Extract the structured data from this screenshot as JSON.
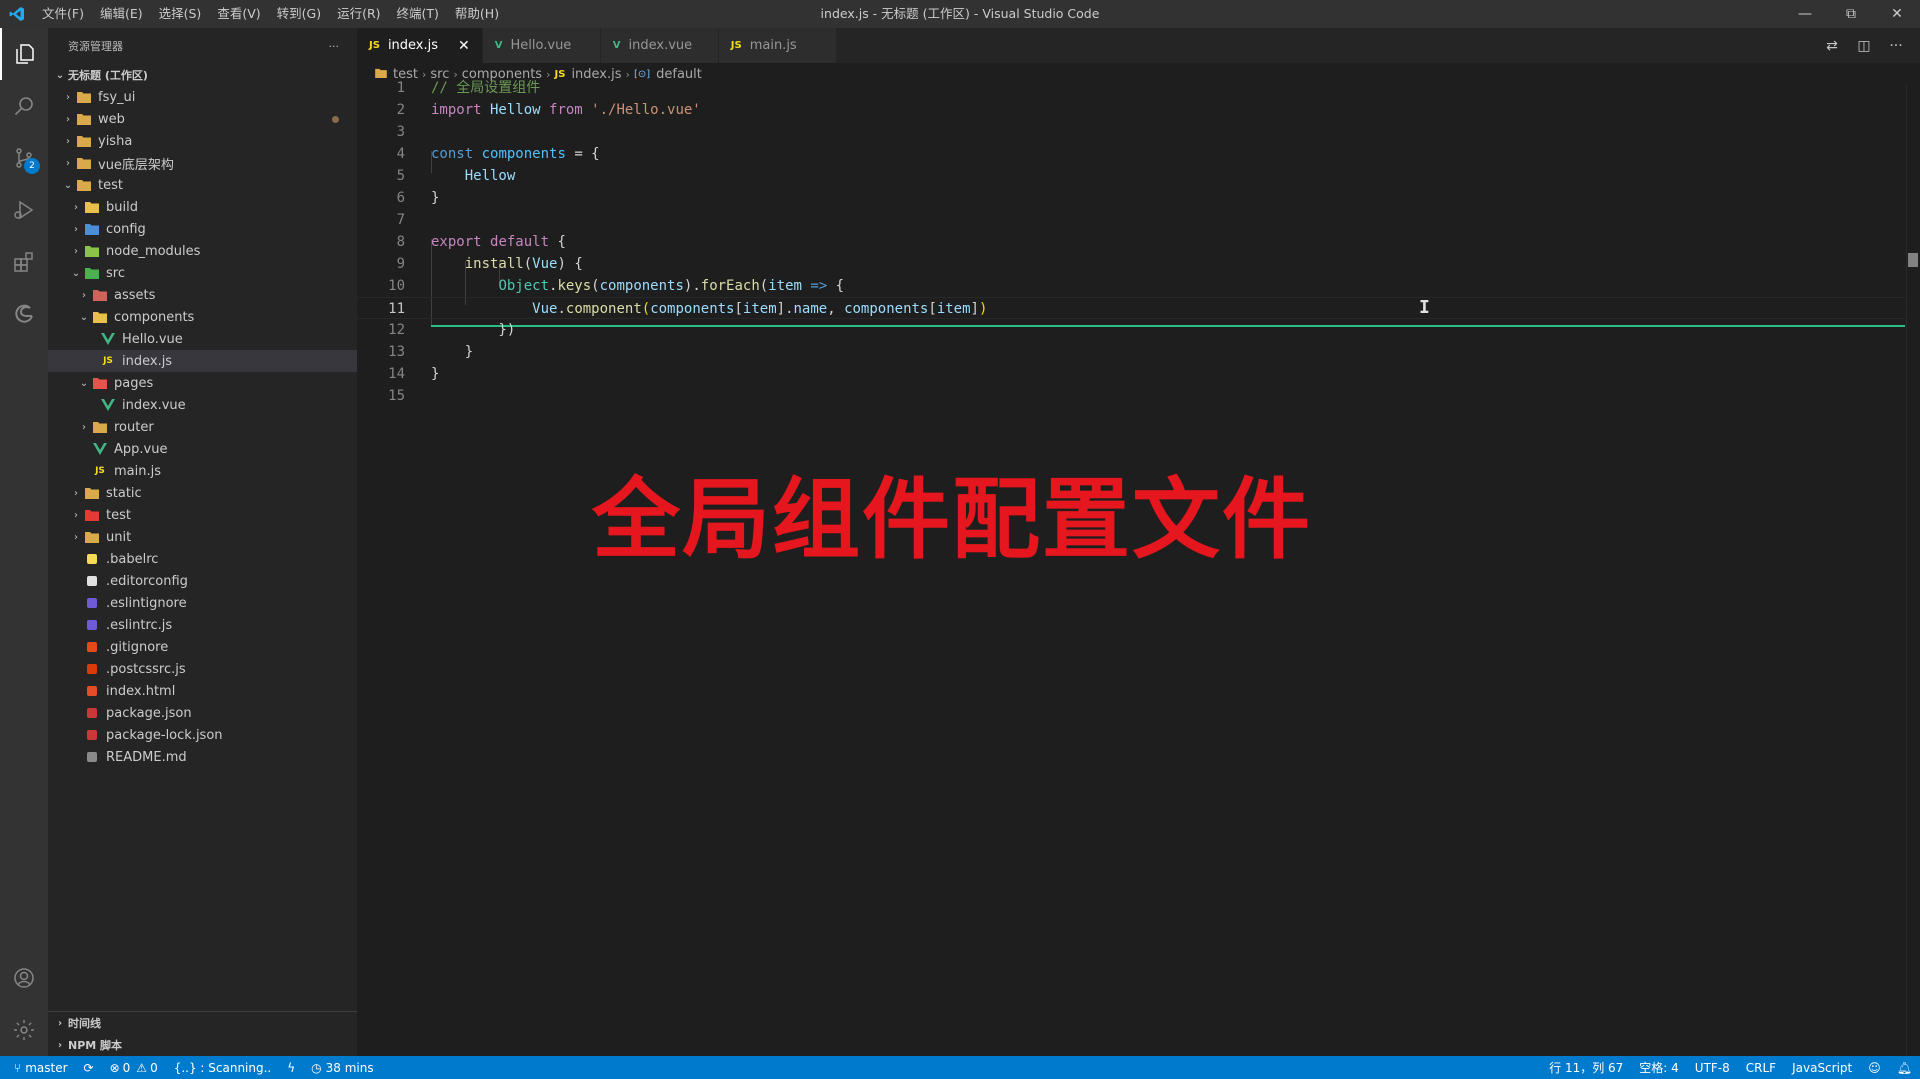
{
  "window": {
    "title": "index.js - 无标题 (工作区) - Visual Studio Code",
    "menu": [
      "文件(F)",
      "编辑(E)",
      "选择(S)",
      "查看(V)",
      "转到(G)",
      "运行(R)",
      "终端(T)",
      "帮助(H)"
    ]
  },
  "activity": {
    "scm_badge": "2"
  },
  "sidebar": {
    "title": "资源管理器",
    "more": "···",
    "workspace": "无标题 (工作区)",
    "tree": [
      {
        "label": "fsy_ui",
        "depth": 1,
        "chev": "›",
        "icon": "folder-icon",
        "color": "#d9a94b"
      },
      {
        "label": "web",
        "depth": 1,
        "chev": "›",
        "icon": "folder-icon",
        "color": "#d9a94b",
        "modified": true
      },
      {
        "label": "yisha",
        "depth": 1,
        "chev": "›",
        "icon": "folder-icon",
        "color": "#d9a94b"
      },
      {
        "label": "vue底层架构",
        "depth": 1,
        "chev": "›",
        "icon": "folder-icon",
        "color": "#d9a94b"
      },
      {
        "label": "test",
        "depth": 1,
        "chev": "⌄",
        "icon": "folder-open-icon",
        "color": "#d9a94b"
      },
      {
        "label": "build",
        "depth": 2,
        "chev": "›",
        "icon": "folder-icon",
        "color": "#e8c04b"
      },
      {
        "label": "config",
        "depth": 2,
        "chev": "›",
        "icon": "folder-config-icon",
        "color": "#4b8fd9"
      },
      {
        "label": "node_modules",
        "depth": 2,
        "chev": "›",
        "icon": "folder-node-icon",
        "color": "#8bc34a"
      },
      {
        "label": "src",
        "depth": 2,
        "chev": "⌄",
        "icon": "folder-src-icon",
        "color": "#4caf50"
      },
      {
        "label": "assets",
        "depth": 3,
        "chev": "›",
        "icon": "folder-assets-icon",
        "color": "#d0635a"
      },
      {
        "label": "components",
        "depth": 3,
        "chev": "⌄",
        "icon": "folder-components-icon",
        "color": "#e8c04b"
      },
      {
        "label": "Hello.vue",
        "depth": 4,
        "chev": "",
        "icon": "vue-icon",
        "color": "#41b883"
      },
      {
        "label": "index.js",
        "depth": 4,
        "chev": "",
        "icon": "js-icon",
        "color": "#f5de19",
        "selected": true
      },
      {
        "label": "pages",
        "depth": 3,
        "chev": "⌄",
        "icon": "folder-pages-icon",
        "color": "#e5534b"
      },
      {
        "label": "index.vue",
        "depth": 4,
        "chev": "",
        "icon": "vue-icon",
        "color": "#41b883"
      },
      {
        "label": "router",
        "depth": 3,
        "chev": "›",
        "icon": "folder-icon",
        "color": "#d9a94b"
      },
      {
        "label": "App.vue",
        "depth": 3,
        "chev": "",
        "icon": "vue-icon",
        "color": "#41b883"
      },
      {
        "label": "main.js",
        "depth": 3,
        "chev": "",
        "icon": "js-icon",
        "color": "#f5de19"
      },
      {
        "label": "static",
        "depth": 2,
        "chev": "›",
        "icon": "folder-icon",
        "color": "#d9a94b"
      },
      {
        "label": "test",
        "depth": 2,
        "chev": "›",
        "icon": "folder-test-icon",
        "color": "#e53935"
      },
      {
        "label": "unit",
        "depth": 2,
        "chev": "›",
        "icon": "folder-icon",
        "color": "#d9a94b"
      },
      {
        "label": ".babelrc",
        "depth": 2,
        "chev": "",
        "icon": "babel-icon",
        "color": "#f5da55"
      },
      {
        "label": ".editorconfig",
        "depth": 2,
        "chev": "",
        "icon": "editorconfig-icon",
        "color": "#e0e0e0"
      },
      {
        "label": ".eslintignore",
        "depth": 2,
        "chev": "",
        "icon": "eslint-icon",
        "color": "#6f5bd6"
      },
      {
        "label": ".eslintrc.js",
        "depth": 2,
        "chev": "",
        "icon": "eslint-icon",
        "color": "#6f5bd6"
      },
      {
        "label": ".gitignore",
        "depth": 2,
        "chev": "",
        "icon": "git-icon",
        "color": "#e64a19"
      },
      {
        "label": ".postcssrc.js",
        "depth": 2,
        "chev": "",
        "icon": "postcss-icon",
        "color": "#dd3a0a"
      },
      {
        "label": "index.html",
        "depth": 2,
        "chev": "",
        "icon": "html-icon",
        "color": "#e44d26"
      },
      {
        "label": "package.json",
        "depth": 2,
        "chev": "",
        "icon": "npm-icon",
        "color": "#cb3837"
      },
      {
        "label": "package-lock.json",
        "depth": 2,
        "chev": "",
        "icon": "npm-icon",
        "color": "#cb3837"
      },
      {
        "label": "README.md",
        "depth": 2,
        "chev": "",
        "icon": "markdown-icon",
        "color": "#8a8a8a"
      }
    ],
    "timeline": "时间线",
    "npm_scripts": "NPM 脚本"
  },
  "tabs": [
    {
      "label": "index.js",
      "icon": "JS",
      "color": "#f5de19",
      "active": true
    },
    {
      "label": "Hello.vue",
      "icon": "V",
      "color": "#41b883"
    },
    {
      "label": "index.vue",
      "icon": "V",
      "color": "#41b883"
    },
    {
      "label": "main.js",
      "icon": "JS",
      "color": "#f5de19"
    }
  ],
  "breadcrumb": [
    "test",
    "src",
    "components",
    "index.js",
    "default"
  ],
  "code": [
    [
      [
        "// 全局设置组件",
        "com"
      ]
    ],
    [
      [
        "import",
        "kw"
      ],
      [
        " Hellow ",
        "var"
      ],
      [
        "from",
        "kw"
      ],
      [
        " './Hello.vue'",
        "str"
      ]
    ],
    [],
    [
      [
        "const",
        "kw2"
      ],
      [
        " ",
        "pun"
      ],
      [
        "components",
        "num"
      ],
      [
        " = {",
        "pun"
      ]
    ],
    [
      [
        "    Hellow",
        "var"
      ]
    ],
    [
      [
        "}",
        "pun"
      ]
    ],
    [],
    [
      [
        "export",
        "kw"
      ],
      [
        " ",
        "pun"
      ],
      [
        "default",
        "kw"
      ],
      [
        " {",
        "pun"
      ]
    ],
    [
      [
        "    ",
        "pun"
      ],
      [
        "install",
        "fn"
      ],
      [
        "(",
        "pun"
      ],
      [
        "Vue",
        "var"
      ],
      [
        ") {",
        "pun"
      ]
    ],
    [
      [
        "        ",
        "pun"
      ],
      [
        "Object",
        "cls"
      ],
      [
        ".",
        "pun"
      ],
      [
        "keys",
        "fn"
      ],
      [
        "(",
        "pun"
      ],
      [
        "components",
        "var"
      ],
      [
        ").",
        "pun"
      ],
      [
        "forEach",
        "fn"
      ],
      [
        "(",
        "pun"
      ],
      [
        "item",
        "var"
      ],
      [
        " ",
        "pun"
      ],
      [
        "=>",
        "kw2"
      ],
      [
        " {",
        "pun"
      ]
    ],
    [
      [
        "            ",
        "pun"
      ],
      [
        "Vue",
        "var"
      ],
      [
        ".",
        "pun"
      ],
      [
        "component",
        "fn"
      ],
      [
        "(",
        "br"
      ],
      [
        "components",
        "var"
      ],
      [
        "[",
        "pun"
      ],
      [
        "item",
        "var"
      ],
      [
        "].",
        "pun"
      ],
      [
        "name",
        "var"
      ],
      [
        ", ",
        "pun"
      ],
      [
        "components",
        "var"
      ],
      [
        "[",
        "pun"
      ],
      [
        "item",
        "var"
      ],
      [
        "]",
        "pun"
      ],
      [
        ")",
        "br"
      ]
    ],
    [
      [
        "        })",
        "pun"
      ]
    ],
    [
      [
        "    }",
        "pun"
      ]
    ],
    [
      [
        "}",
        "pun"
      ]
    ],
    []
  ],
  "overlay": "全局组件配置文件",
  "status": {
    "branch": "master",
    "errors": "0",
    "warnings": "0",
    "scanning": "{..} : Scanning..",
    "time": "38 mins",
    "position": "行 11，列 67",
    "spaces": "空格: 4",
    "encoding": "UTF-8",
    "eol": "CRLF",
    "language": "JavaScript"
  }
}
